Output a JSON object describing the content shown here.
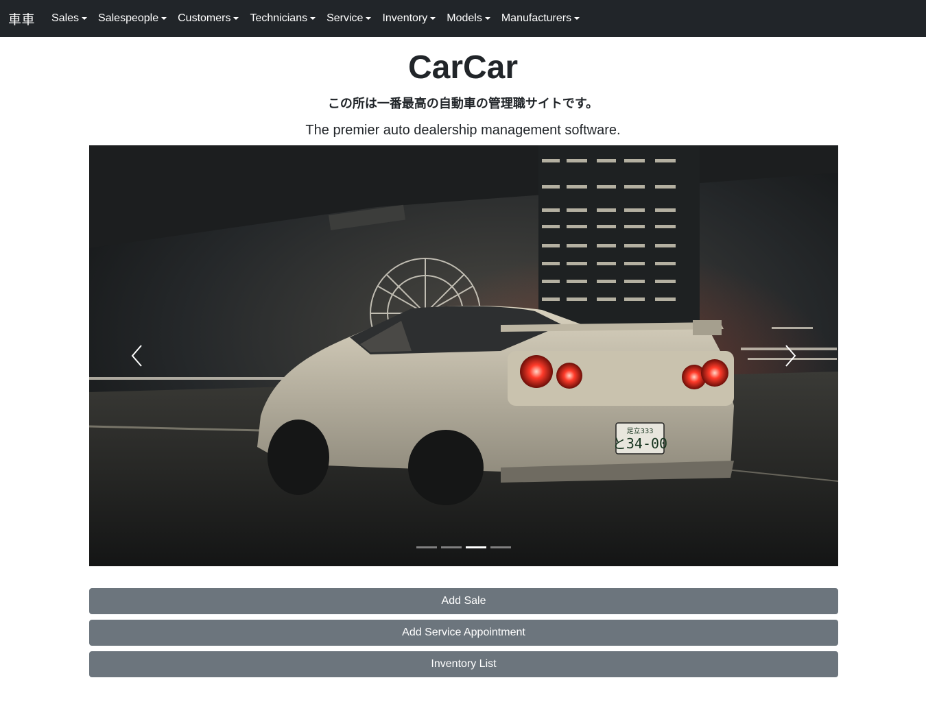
{
  "nav": {
    "brand": "車車",
    "items": [
      {
        "label": "Sales"
      },
      {
        "label": "Salespeople"
      },
      {
        "label": "Customers"
      },
      {
        "label": "Technicians"
      },
      {
        "label": "Service"
      },
      {
        "label": "Inventory"
      },
      {
        "label": "Models"
      },
      {
        "label": "Manufacturers"
      }
    ]
  },
  "header": {
    "title": "CarCar",
    "subtitle_jp": "この所は一番最高の自動車の管理職サイトです。",
    "lead": "The premier auto dealership management software."
  },
  "carousel": {
    "slide_count": 4,
    "active_index": 2,
    "image_subject": "white sports car at night in front of city skyline",
    "plate_line1": "足立333",
    "plate_line2": "と34-00"
  },
  "actions": {
    "add_sale": "Add Sale",
    "add_service": "Add Service Appointment",
    "inventory_list": "Inventory List"
  },
  "colors": {
    "navbar_bg": "#212529",
    "button_bg": "#6c757d",
    "text": "#212529"
  }
}
